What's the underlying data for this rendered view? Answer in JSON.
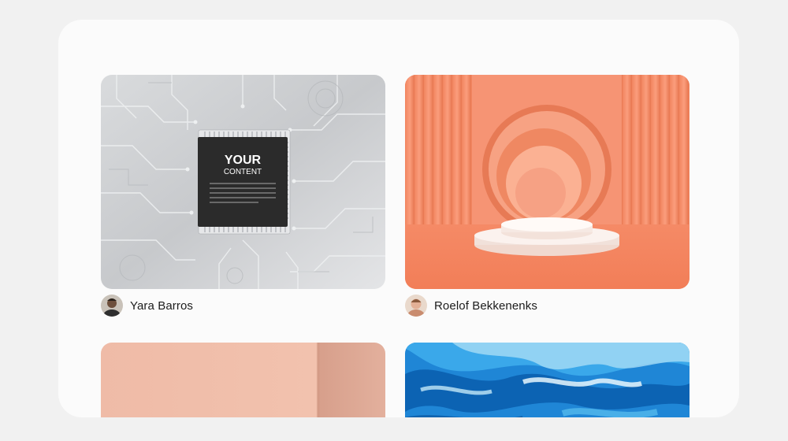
{
  "gallery": {
    "cards": [
      {
        "image": "circuit-board-chip-mockup",
        "chip_title": "YOUR",
        "chip_subtitle": "CONTENT",
        "author": {
          "name": "Yara Barros",
          "avatar": "avatar-yara-barros"
        }
      },
      {
        "image": "orange-3d-podium-scene",
        "author": {
          "name": "Roelof Bekkenenks",
          "avatar": "avatar-roelof-bekkenenks"
        }
      },
      {
        "image": "peach-gradient-panels"
      },
      {
        "image": "blue-fluid-marble"
      }
    ]
  },
  "colors": {
    "page_background": "#f1f1f1",
    "panel_background": "#fbfbfb",
    "orange_scene": "#f48c6a",
    "chip": "#2b2b2b",
    "peach": "#efb6a2",
    "fluid_blue": "#1f86d6"
  }
}
